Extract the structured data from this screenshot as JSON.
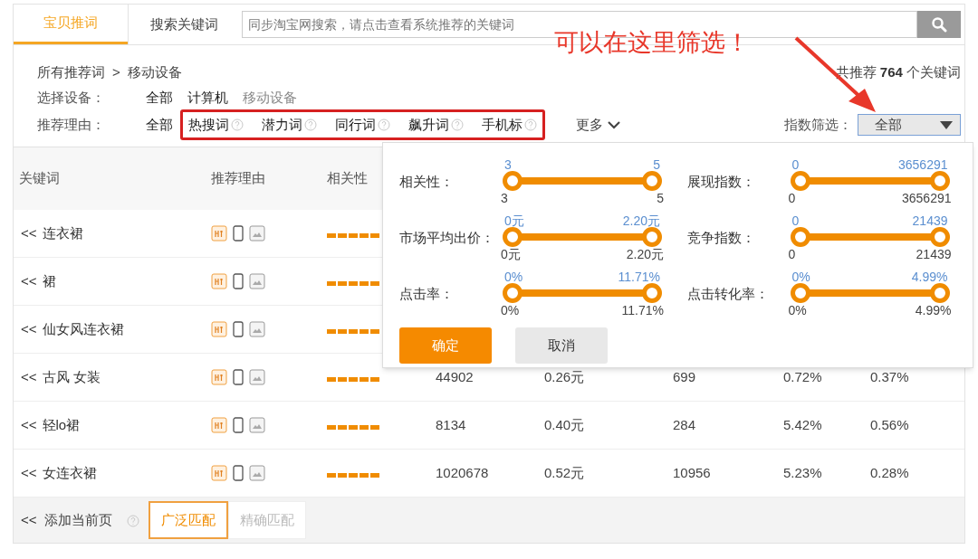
{
  "tabs": [
    {
      "label": "宝贝推词",
      "selected": true
    },
    {
      "label": "搜索关键词",
      "selected": false
    }
  ],
  "search": {
    "placeholder": "同步淘宝网搜索，请点击查看系统推荐的关键词"
  },
  "annotation": {
    "text": "可以在这里筛选！"
  },
  "breadcrumb": {
    "root": "所有推荐词",
    "separator": ">",
    "current": "移动设备"
  },
  "total": {
    "prefix": "共推荐",
    "count": "764",
    "suffix": "个关键词"
  },
  "device_filter": {
    "label": "选择设备：",
    "options": [
      {
        "label": "全部",
        "selected": false
      },
      {
        "label": "计算机",
        "selected": false
      },
      {
        "label": "移动设备",
        "selected": true
      }
    ]
  },
  "reason_filter": {
    "label": "推荐理由：",
    "all": "全部",
    "options": [
      "热搜词",
      "潜力词",
      "同行词",
      "飙升词",
      "手机标"
    ],
    "more": "更多"
  },
  "index_filter": {
    "label": "指数筛选：",
    "value": "全部"
  },
  "table": {
    "columns": [
      "关键词",
      "推荐理由",
      "相关性"
    ],
    "rows": [
      {
        "prefix": "<<",
        "keyword": "连衣裙",
        "stars": 5
      },
      {
        "prefix": "<<",
        "keyword": "裙",
        "stars": 5
      },
      {
        "prefix": "<<",
        "keyword": "仙女风连衣裙",
        "stars": 5
      },
      {
        "prefix": "<<",
        "keyword": "古风 女装",
        "stars": 5,
        "values": [
          "44902",
          "0.26元",
          "699",
          "0.72%",
          "0.37%"
        ]
      },
      {
        "prefix": "<<",
        "keyword": "轻lo裙",
        "stars": 5,
        "values": [
          "8134",
          "0.40元",
          "284",
          "5.42%",
          "0.56%"
        ]
      },
      {
        "prefix": "<<",
        "keyword": "女连衣裙",
        "stars": 5,
        "values": [
          "1020678",
          "0.52元",
          "10956",
          "5.23%",
          "0.28%"
        ]
      }
    ]
  },
  "footer": {
    "prefix": "<<",
    "add_label": "添加当前页",
    "match": [
      {
        "label": "广泛匹配",
        "selected": true
      },
      {
        "label": "精确匹配",
        "selected": false
      }
    ]
  },
  "popup": {
    "sliders": [
      {
        "label": "相关性：",
        "top_min": "3",
        "top_max": "5",
        "bottom_min": "3",
        "bottom_max": "5",
        "level": 1
      },
      {
        "label": "展现指数：",
        "top_min": "0",
        "top_max": "3656291",
        "bottom_min": "0",
        "bottom_max": "3656291",
        "level": 1
      },
      {
        "label": "市场平均出价：",
        "top_min": "0元",
        "top_max": "2.20元",
        "bottom_min": "0元",
        "bottom_max": "2.20元",
        "level": 1
      },
      {
        "label": "竞争指数：",
        "top_min": "0",
        "top_max": "21439",
        "bottom_min": "0",
        "bottom_max": "21439",
        "level": 1
      },
      {
        "label": "点击率：",
        "top_min": "0%",
        "top_max": "11.71%",
        "bottom_min": "0%",
        "bottom_max": "11.71%",
        "level": 1
      },
      {
        "label": "点击转化率：",
        "top_min": "0%",
        "top_max": "4.99%",
        "bottom_min": "0%",
        "bottom_max": "4.99%",
        "level": 1
      }
    ],
    "buttons": [
      {
        "label": "确定",
        "kind": "primary"
      },
      {
        "label": "取消",
        "kind": "secondary"
      }
    ]
  }
}
